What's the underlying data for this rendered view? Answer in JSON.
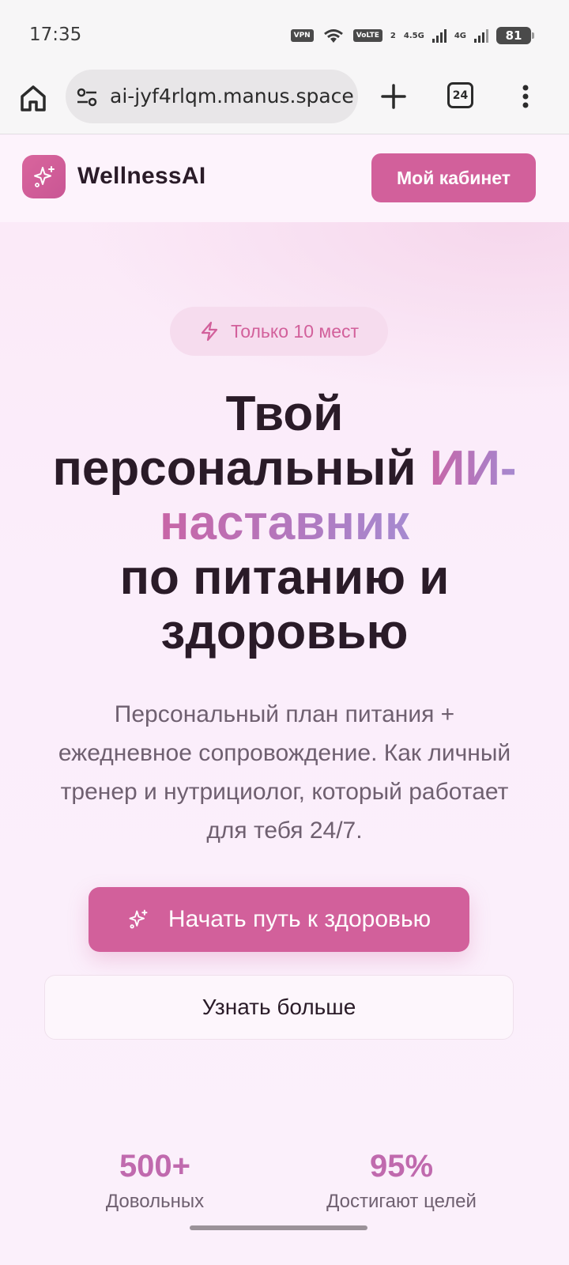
{
  "status_bar": {
    "time": "17:35",
    "vpn": "VPN",
    "volte": "VoLTE",
    "volte_sub": "2",
    "net1": "4.5G",
    "net2": "4G",
    "battery": "81"
  },
  "browser": {
    "url": "ai-jyf4rlqm.manus.space",
    "tab_count": "24",
    "icons": [
      "home-icon",
      "site-settings-icon",
      "plus-icon",
      "tabs-icon",
      "more-vert-icon"
    ]
  },
  "header": {
    "logo_text": "WellnessAI",
    "cabinet_label": "Мой кабинет"
  },
  "hero": {
    "badge": "Только 10 мест",
    "title_line1": "Твой",
    "title_line2_a": "персональный ",
    "title_accent_1": "ИИ-",
    "title_accent_2": "наставник",
    "title_line4": "по питанию и",
    "title_line5": "здоровью",
    "subtitle": "Персональный план питания + ежедневное сопровождение. Как личный тренер и нутрициолог, который работает для тебя 24/7.",
    "cta_primary": "Начать путь к здоровью",
    "cta_secondary": "Узнать больше"
  },
  "stats": [
    {
      "value": "500+",
      "label": "Довольных"
    },
    {
      "value": "95%",
      "label": "Достигают целей"
    }
  ],
  "colors": {
    "primary": "#d2609b",
    "accent_gradient_start": "#c865a6",
    "accent_gradient_end": "#a68ad0",
    "text_dark": "#2a1b28",
    "text_muted": "#6f6070"
  }
}
